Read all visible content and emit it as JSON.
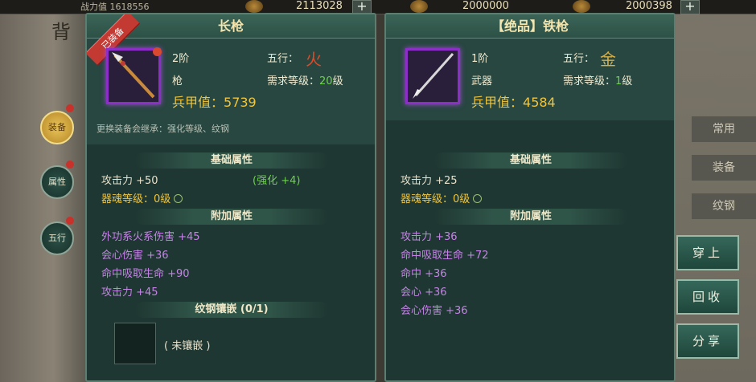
{
  "topbar": {
    "left_text": "战力值 1618556",
    "gold_left": "2113028",
    "gold_mid": "2000000",
    "gold_right": "2000398",
    "plus": "+"
  },
  "left_title": "背",
  "side_tabs": [
    {
      "label": "装备",
      "active": true
    },
    {
      "label": "属性",
      "active": false
    },
    {
      "label": "五行",
      "active": false
    }
  ],
  "right_tabs": [
    "常用",
    "装备",
    "纹钢"
  ],
  "actions": [
    "穿上",
    "回收",
    "分享"
  ],
  "equipped": {
    "title": "长枪",
    "ribbon": "已装备",
    "tier": "2阶",
    "elem_label": "五行：",
    "elem_char": "火",
    "type": "枪",
    "req_label": "需求等级：",
    "req_level": "20",
    "req_unit": "级",
    "power_label": "兵甲值：",
    "power": "5739",
    "note": "更换装备会继承：强化等级、纹钢",
    "base_title": "基础属性",
    "attack": "攻击力 +50",
    "enhance": "(强化 +4)",
    "soul": "器魂等级：0级",
    "extra_title": "附加属性",
    "extras": [
      "外功系火系伤害 +45",
      "会心伤害 +36",
      "命中吸取生命 +90",
      "攻击力 +45"
    ],
    "gem_title": "纹钢镶嵌 (0/1)",
    "gem_empty": "( 未镶嵌 )"
  },
  "candidate": {
    "title": "【绝品】铁枪",
    "tier": "1阶",
    "elem_label": "五行：",
    "elem_char": "金",
    "type": "武器",
    "req_label": "需求等级：",
    "req_level": "1",
    "req_unit": "级",
    "power_label": "兵甲值：",
    "power": "4584",
    "base_title": "基础属性",
    "attack": "攻击力 +25",
    "soul": "器魂等级：0级",
    "extra_title": "附加属性",
    "extras": [
      "攻击力 +36",
      "命中吸取生命 +72",
      "命中 +36",
      "会心 +36",
      "会心伤害 +36"
    ]
  },
  "colors": {
    "panel": "#1f3732",
    "gold": "#f0c53b",
    "green": "#6fd24e",
    "purple": "#c682e8",
    "rare_border": "#8b2fc7",
    "ribbon": "#c23a32"
  },
  "icons": [
    "spear-icon",
    "iron-spear-icon",
    "coin-icon",
    "plus-icon",
    "circle-icon"
  ]
}
